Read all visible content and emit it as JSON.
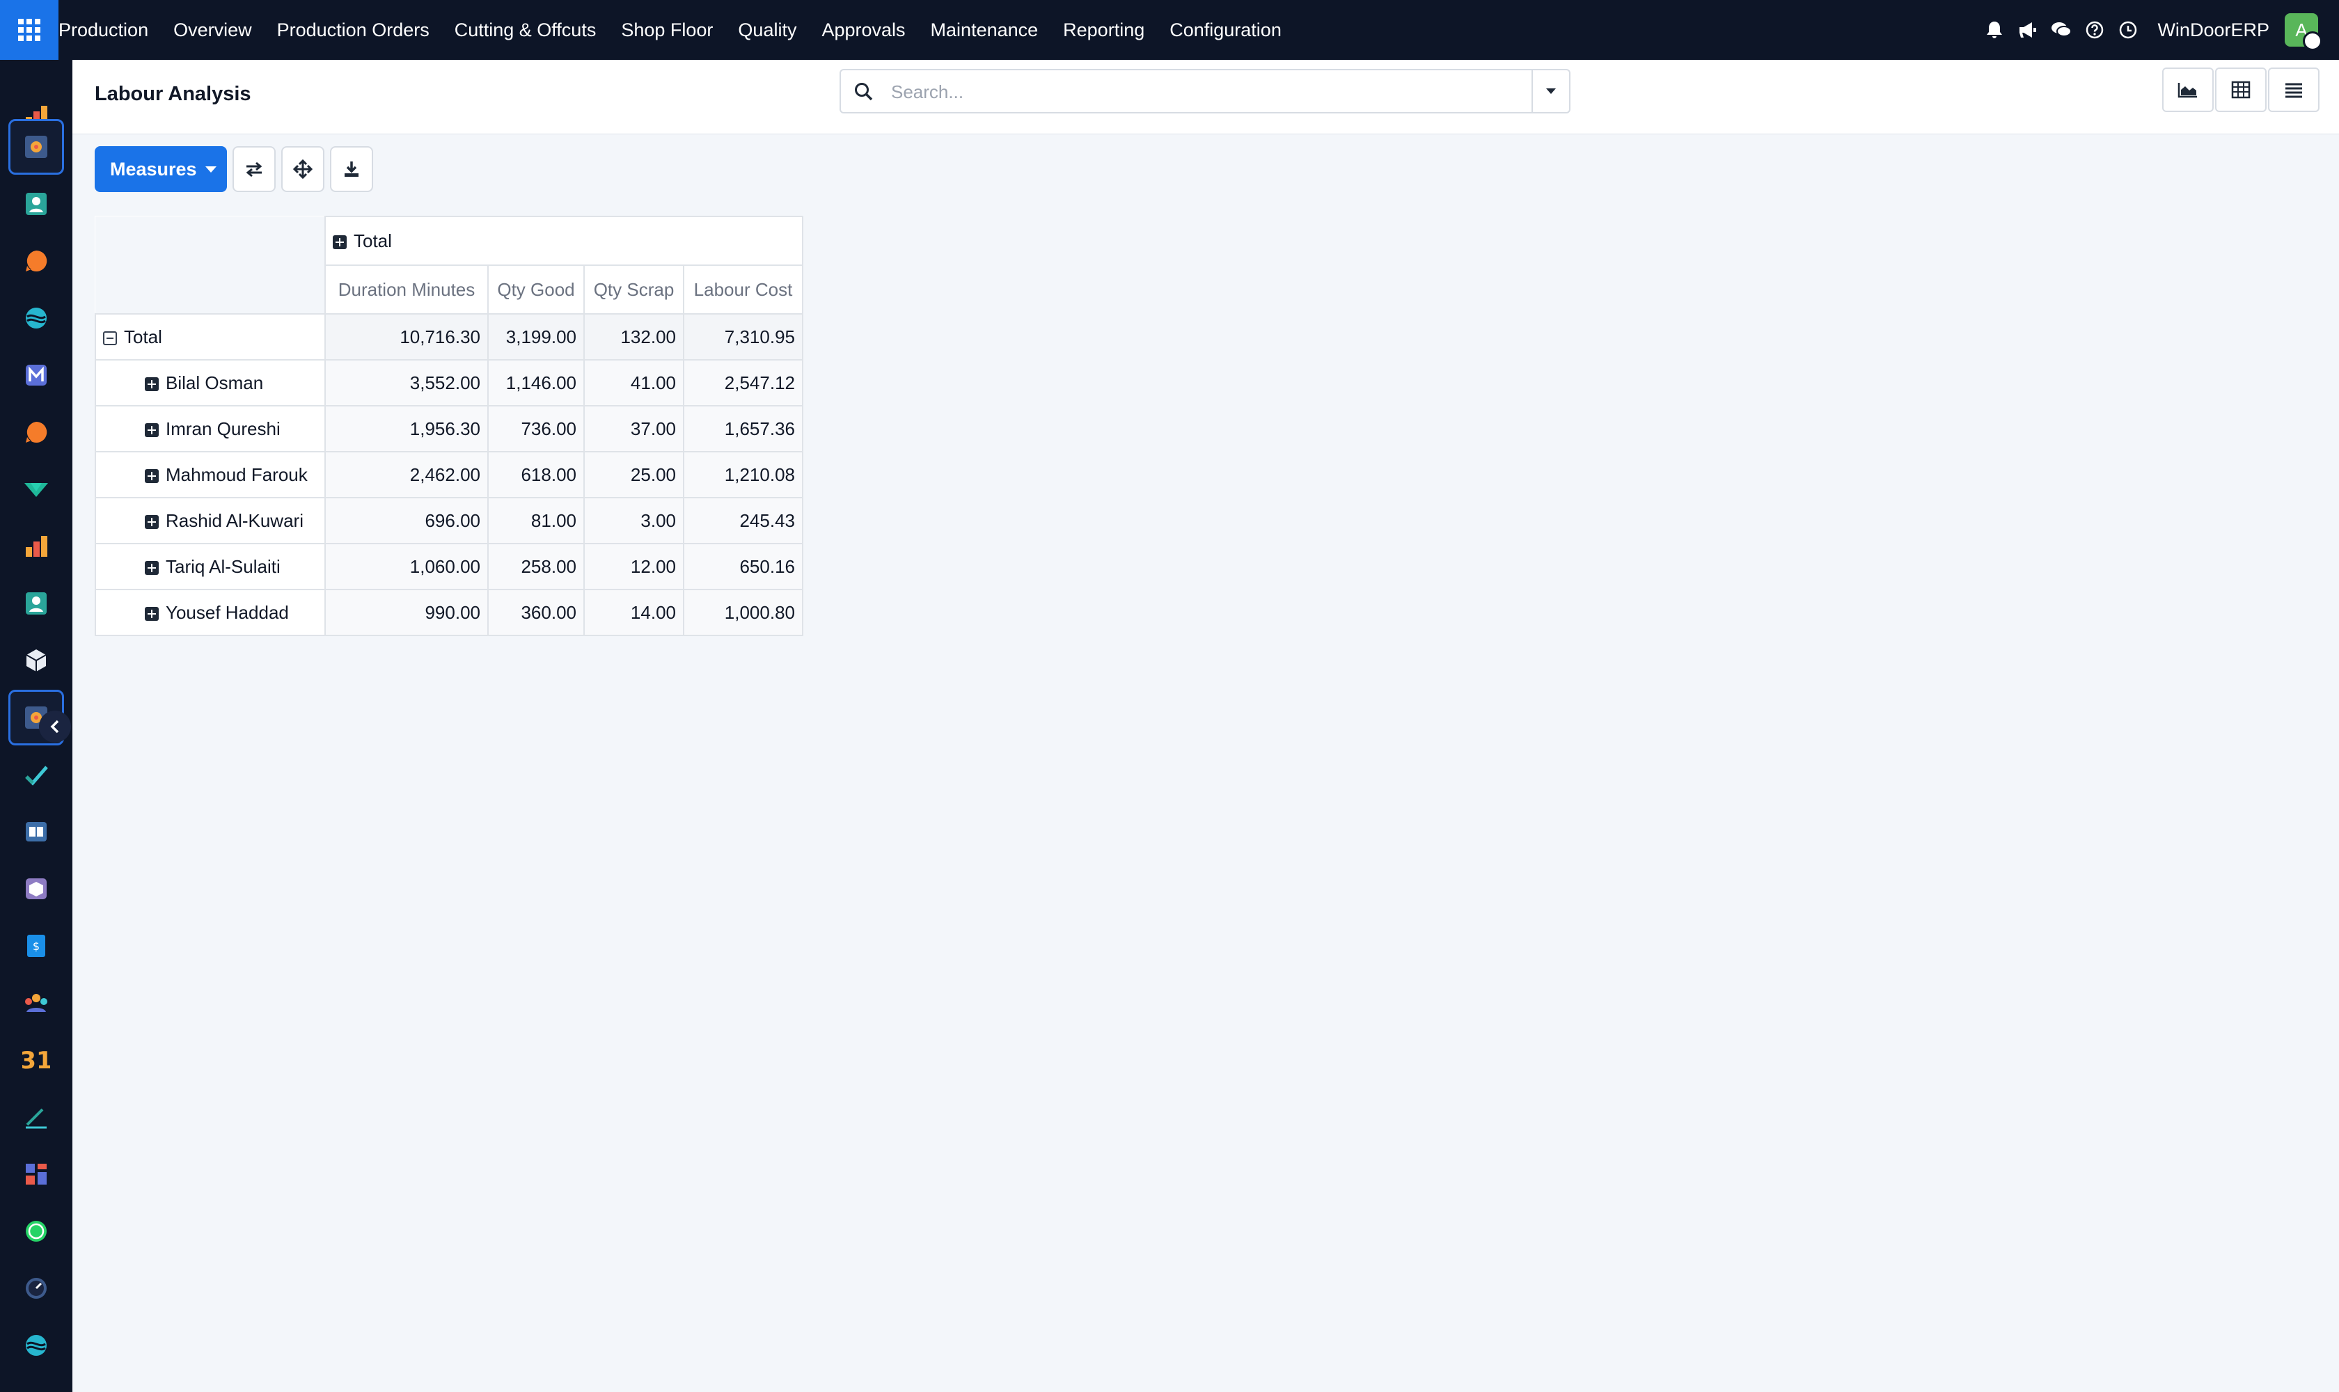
{
  "nav": {
    "menu": [
      "Production",
      "Overview",
      "Production Orders",
      "Cutting & Offcuts",
      "Shop Floor",
      "Quality",
      "Approvals",
      "Maintenance",
      "Reporting",
      "Configuration"
    ],
    "icons": [
      "bell-icon",
      "megaphone-icon",
      "chat-icon",
      "help-icon",
      "clock-icon"
    ],
    "company": "WinDoorERP",
    "avatar_letter": "A",
    "avatar_color": "#59b65a"
  },
  "control": {
    "title": "Labour Analysis",
    "search_placeholder": "Search...",
    "views": [
      "graph-view-icon",
      "pivot-view-icon",
      "list-view-icon"
    ]
  },
  "toolbar": {
    "measures_label": "Measures",
    "buttons": [
      "flip-axis-icon",
      "expand-all-icon",
      "download-icon"
    ]
  },
  "pivot": {
    "col_header": "Total",
    "measures": [
      "Duration Minutes",
      "Qty Good",
      "Qty Scrap",
      "Labour Cost"
    ],
    "total_row": {
      "label": "Total",
      "values": [
        "10,716.30",
        "3,199.00",
        "132.00",
        "7,310.95"
      ]
    },
    "rows": [
      {
        "label": "Bilal Osman",
        "values": [
          "3,552.00",
          "1,146.00",
          "41.00",
          "2,547.12"
        ]
      },
      {
        "label": "Imran Qureshi",
        "values": [
          "1,956.30",
          "736.00",
          "37.00",
          "1,657.36"
        ]
      },
      {
        "label": "Mahmoud Farouk",
        "values": [
          "2,462.00",
          "618.00",
          "25.00",
          "1,210.08"
        ]
      },
      {
        "label": "Rashid Al-Kuwari",
        "values": [
          "696.00",
          "81.00",
          "3.00",
          "245.43"
        ]
      },
      {
        "label": "Tariq Al-Sulaiti",
        "values": [
          "1,060.00",
          "258.00",
          "12.00",
          "650.16"
        ]
      },
      {
        "label": "Yousef Haddad",
        "values": [
          "990.00",
          "360.00",
          "14.00",
          "1,000.80"
        ]
      }
    ]
  },
  "colors": {
    "accent": "#1a73e8",
    "navbar": "#0d1527",
    "background": "#f3f6fa"
  }
}
